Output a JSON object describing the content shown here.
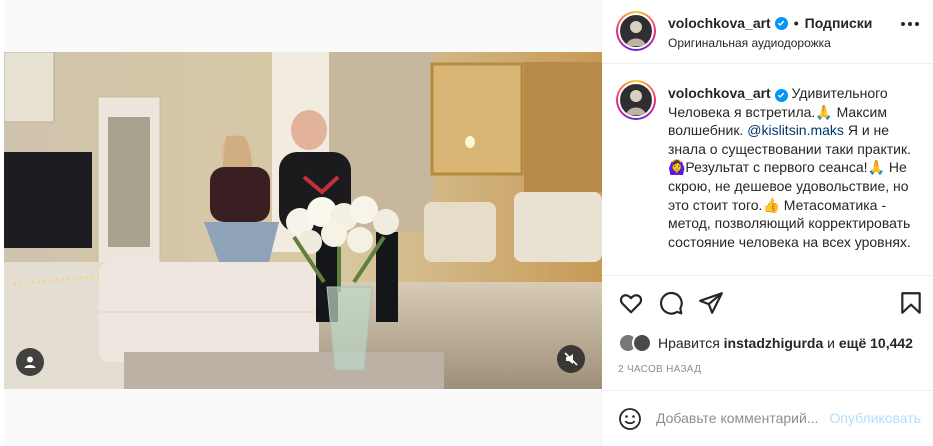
{
  "header": {
    "username": "volochkova_art",
    "separator": "•",
    "follow_label": "Подписки",
    "audio_label": "Оригинальная аудиодорожка"
  },
  "caption": {
    "username": "volochkova_art",
    "text_part1": " Удивительного Человека я встретила.🙏 Максим волшебник. ",
    "mention": "@kislitsin.maks",
    "text_part2": " Я и не знала о существовании таки практик. 🙆‍♀️Результат с первого сеанса!🙏 Не скрою, не дешевое удовольствие, но это стоит того.👍 Метасоматика - метод, позволяющий корректировать состояние человека на всех уровнях."
  },
  "likes": {
    "prefix": "Нравится ",
    "user": "instadzhigurda",
    "middle": " и ",
    "count": "ещё 10,442"
  },
  "timestamp": "2 ЧАСОВ НАЗАД",
  "comment": {
    "placeholder": "Добавьте комментарий...",
    "post_label": "Опубликовать"
  },
  "icons": {
    "like": "heart-icon",
    "comment": "comment-icon",
    "share": "send-icon",
    "save": "bookmark-icon",
    "more": "more-icon",
    "emoji": "emoji-icon",
    "mute": "sound-off-icon",
    "tags": "user-tag-icon"
  },
  "colors": {
    "verified": "#0095f6",
    "mention": "#00376b",
    "post_disabled": "#b2dffc"
  }
}
